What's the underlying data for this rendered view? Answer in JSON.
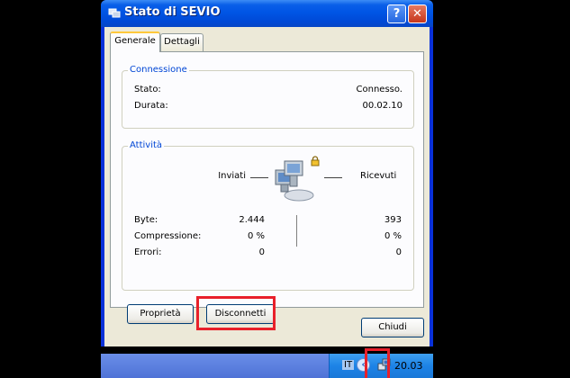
{
  "window": {
    "title": "Stato di SEVIO",
    "help_glyph": "?",
    "close_glyph": "✕"
  },
  "tabs": [
    {
      "label": "Generale",
      "active": true
    },
    {
      "label": "Dettagli",
      "active": false
    }
  ],
  "connection": {
    "legend": "Connessione",
    "status_label": "Stato:",
    "status_value": "Connesso.",
    "duration_label": "Durata:",
    "duration_value": "00.02.10"
  },
  "activity": {
    "legend": "Attività",
    "sent_label": "Inviati",
    "received_label": "Ricevuti",
    "rows": [
      {
        "label": "Byte:",
        "sent": "2.444",
        "received": "393"
      },
      {
        "label": "Compressione:",
        "sent": "0 %",
        "received": "0 %"
      },
      {
        "label": "Errori:",
        "sent": "0",
        "received": "0"
      }
    ]
  },
  "buttons": {
    "properties": "Proprietà",
    "disconnect": "Disconnetti",
    "close": "Chiudi"
  },
  "taskbar": {
    "language": "IT",
    "chevron": "‹",
    "clock": "20.03"
  },
  "colors": {
    "highlight_box": "#e8202a",
    "group_legend": "#0046d5",
    "titlebar": "#0055e5"
  },
  "icons": [
    "help-icon",
    "close-icon",
    "network-computers-icon",
    "lock-icon",
    "network-tray-icon",
    "chevron-left-icon"
  ]
}
